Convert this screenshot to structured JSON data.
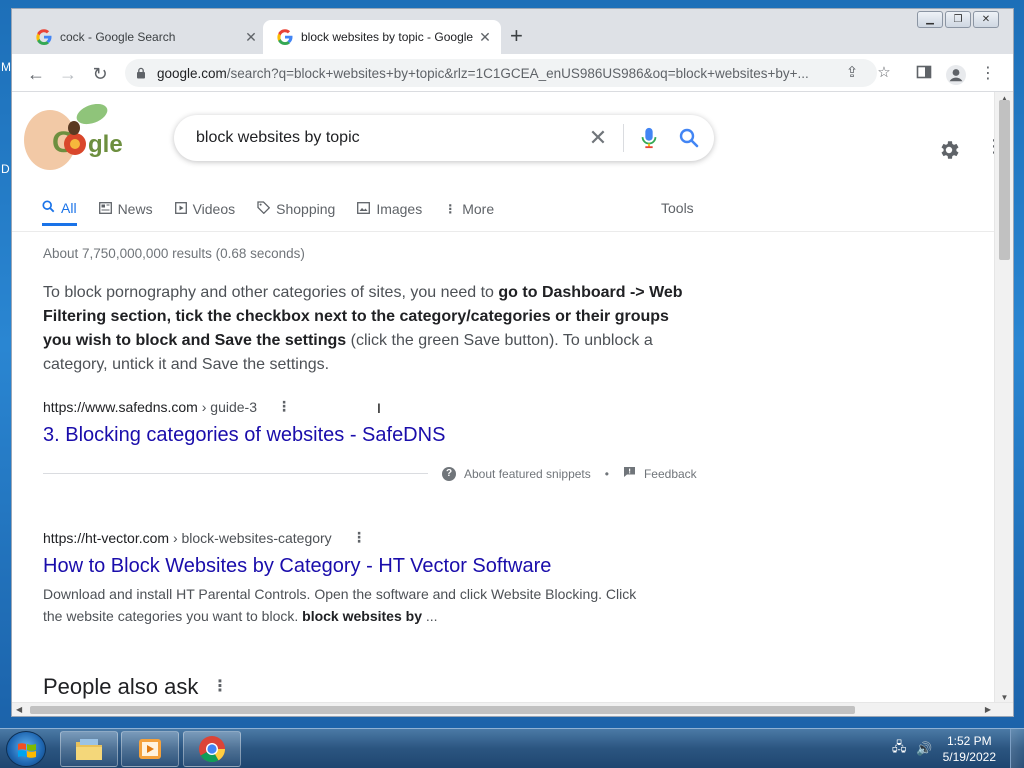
{
  "desktop": {
    "letter_top": "M",
    "letter_mid": "D"
  },
  "browser": {
    "tabs": [
      {
        "title": "cock - Google Search",
        "active": false
      },
      {
        "title": "block websites by topic - Google Search",
        "active": true
      }
    ],
    "newtab_symbol": "+",
    "window_controls": [
      "minimize",
      "maximize",
      "close"
    ],
    "address": {
      "host": "google.com",
      "path": "/search?q=block+websites+by+topic&rlz=1C1GCEA_enUS986US986&oq=block+websites+by+..."
    }
  },
  "search": {
    "query": "block websites by topic",
    "nav": [
      {
        "label": "All",
        "icon": "search-icon",
        "active": true
      },
      {
        "label": "News",
        "icon": "news-icon",
        "active": false
      },
      {
        "label": "Videos",
        "icon": "play-icon",
        "active": false
      },
      {
        "label": "Shopping",
        "icon": "tag-icon",
        "active": false
      },
      {
        "label": "Images",
        "icon": "image-icon",
        "active": false
      },
      {
        "label": "More",
        "icon": "more-vert-icon",
        "active": false
      }
    ],
    "tools_label": "Tools",
    "stats": "About 7,750,000,000 results (0.68 seconds)"
  },
  "featured_snippet": {
    "text_1": "To block pornography and other categories of sites, you need to ",
    "bold_1": "go to Dashboard -> Web Filtering section, tick the checkbox next to the category/categories or their groups you wish to block and Save the settings",
    "text_2": " (click the green Save button). To unblock a category, untick it and Save the settings.",
    "cite_url": "https://www.safedns.com",
    "cite_crumb": " › guide-3",
    "link_title": "3. Blocking categories of websites - SafeDNS",
    "about_label": "About featured snippets",
    "separator": "•",
    "feedback_label": "Feedback"
  },
  "result_2": {
    "cite_url": "https://ht-vector.com",
    "cite_crumb": " › block-websites-category",
    "link_title": "How to Block Websites by Category - HT Vector Software",
    "desc_text": "Download and install HT Parental Controls. Open the software and click Website Blocking. Click the website categories you want to block. ",
    "desc_bold": "block websites by",
    "desc_tail": " ..."
  },
  "people_also_ask": {
    "heading": "People also ask"
  },
  "taskbar": {
    "time": "1:52 PM",
    "date": "5/19/2022",
    "apps": [
      "file-explorer",
      "media-player",
      "chrome"
    ]
  },
  "colors": {
    "link": "#1a0dab",
    "active_tab": "#1a73e8",
    "desktop_blue": "#2a86d2"
  }
}
